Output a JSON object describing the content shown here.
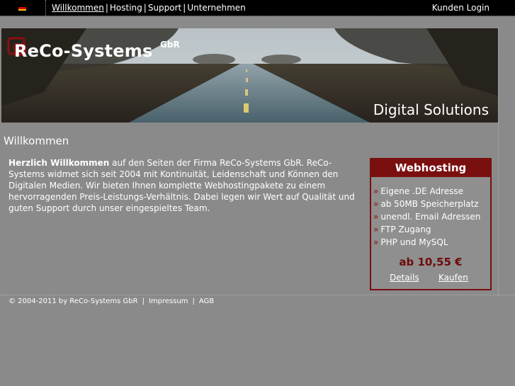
{
  "header": {
    "language_flag": "german-flag-icon",
    "nav": [
      "Willkommen",
      "Hosting",
      "Support",
      "Unternehmen"
    ],
    "login": "Kunden Login"
  },
  "banner": {
    "brand": "ReCo-Systems",
    "brand_suffix": "GbR",
    "tagline": "Digital Solutions"
  },
  "main": {
    "title": "Willkommen",
    "intro_bold": "Herzlich Willkommen",
    "intro_rest": " auf den Seiten der Firma ReCo-Systems GbR. ReCo-Systems widmet sich seit 2004 mit Kontinuität, Leidenschaft und Können den Digitalen Medien. Wir bieten Ihnen komplette Webhostingpakete zu einem hervorragenden Preis-Leistungs-Verhältnis. Dabei legen wir Wert auf Qualität und guten Support durch unser eingespieltes Team."
  },
  "webhosting_box": {
    "title": "Webhosting",
    "bullet": "»",
    "features": [
      "Eigene .DE Adresse",
      "ab 50MB Speicherplatz",
      "unendl. Email Adressen",
      "FTP Zugang",
      "PHP und MySQL"
    ],
    "price": "ab 10,55 €",
    "details_link": "Details",
    "buy_link": "Kaufen"
  },
  "footer": {
    "copyright": "© 2004-2011 by ReCo-Systems GbR",
    "impressum": "Impressum",
    "agb": "AGB"
  },
  "colors": {
    "background": "#8a8a8a",
    "topbar": "#000000",
    "accent": "#7a0f0f"
  }
}
